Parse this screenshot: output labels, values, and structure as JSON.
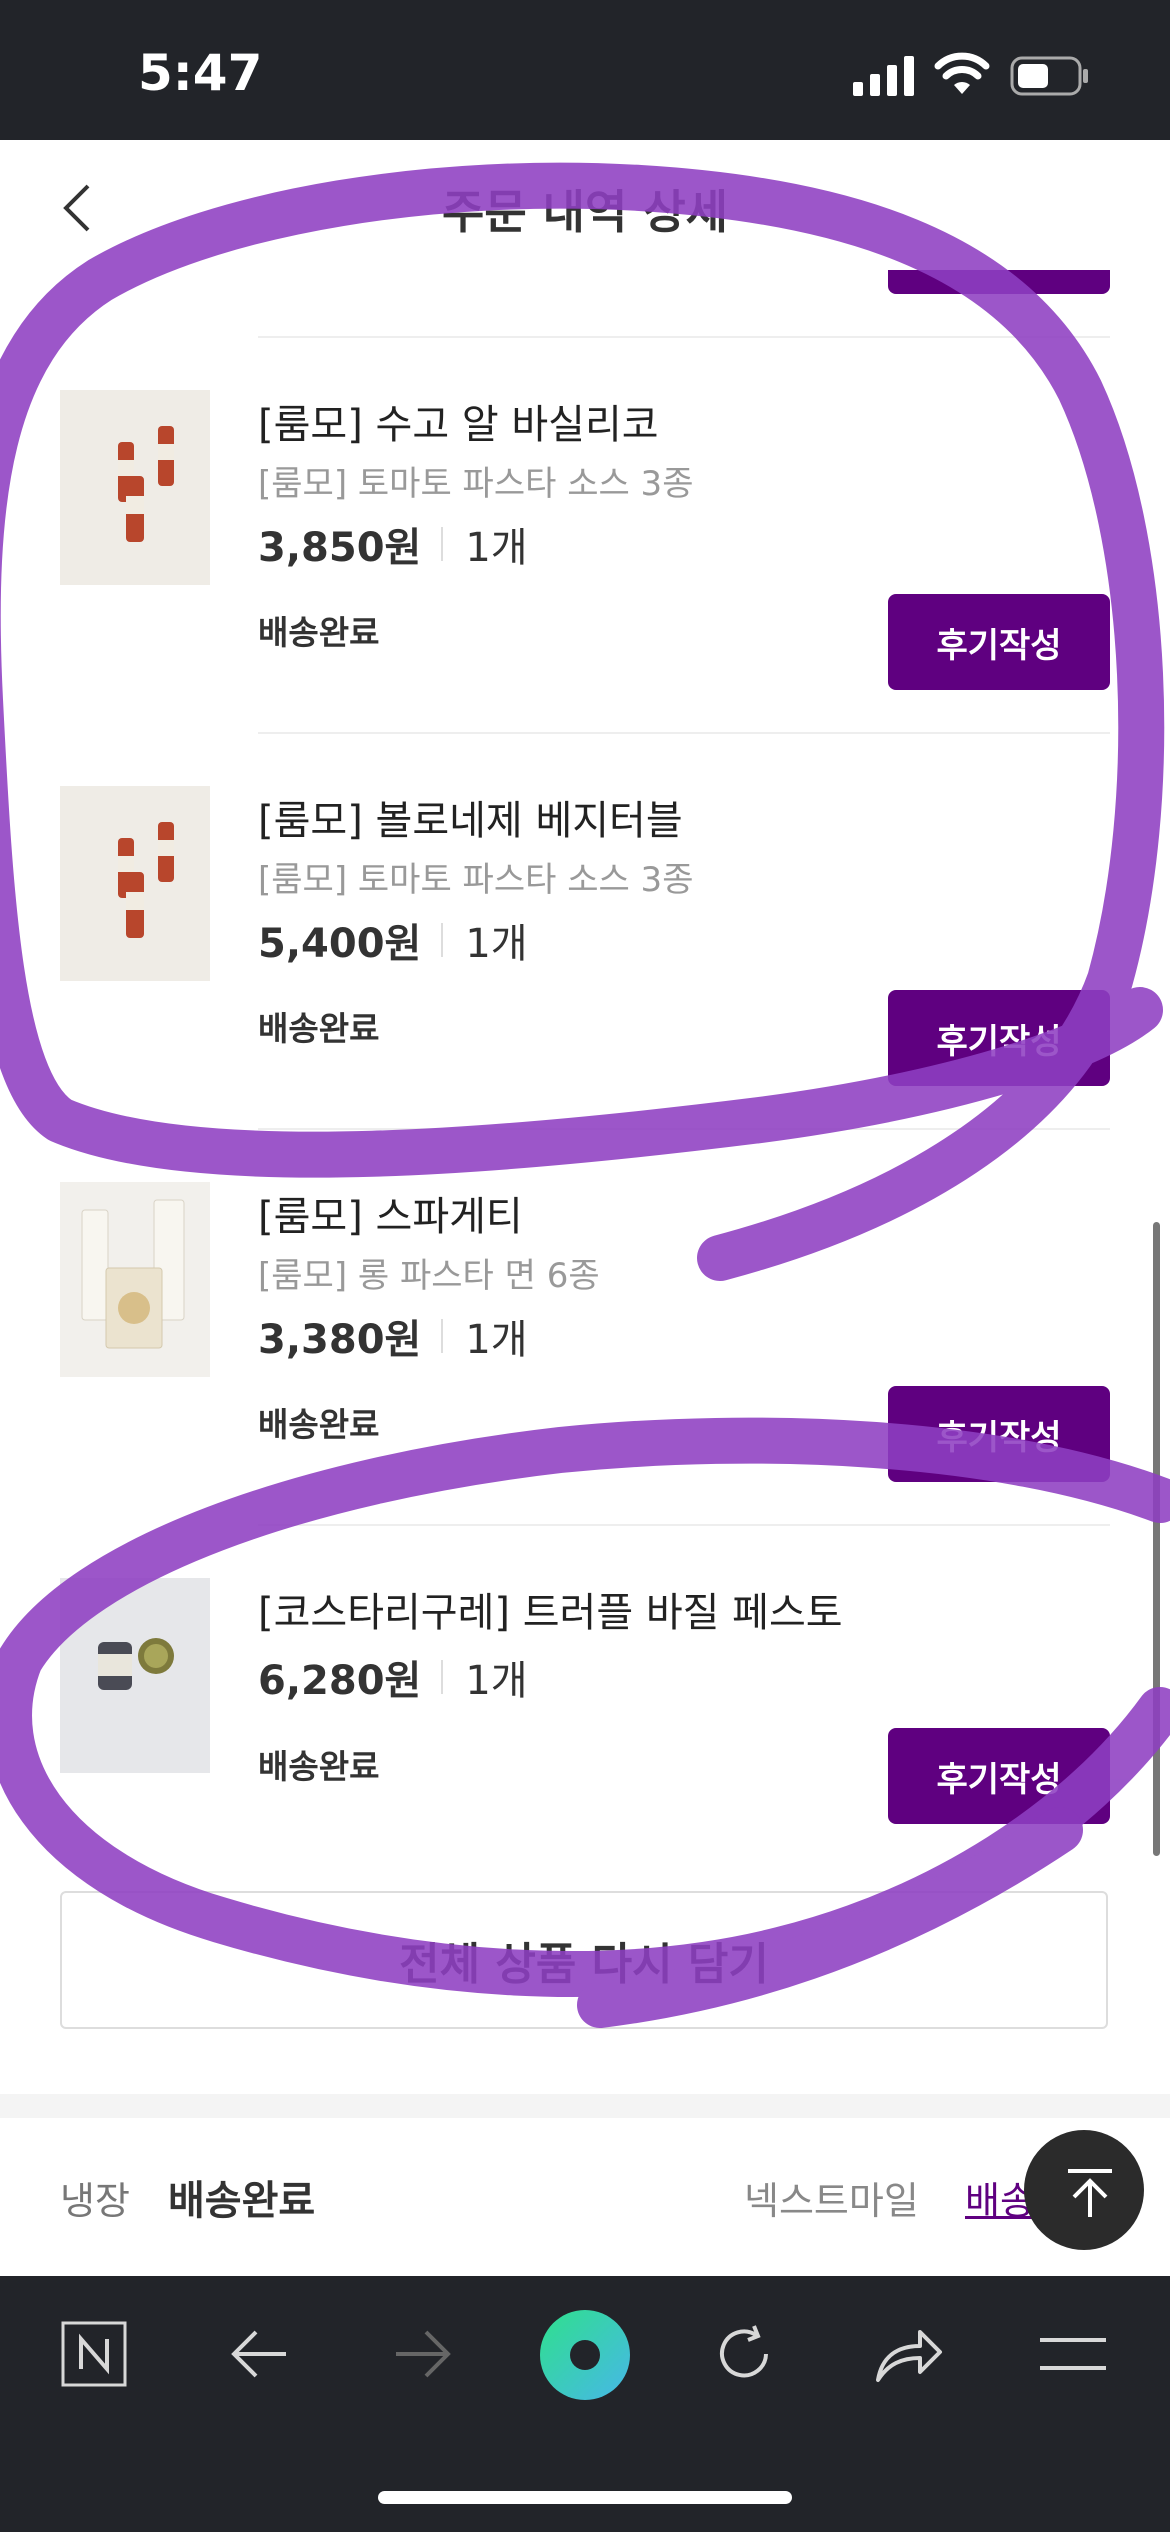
{
  "status_bar": {
    "time": "5:47"
  },
  "header": {
    "title": "주문 내역 상세"
  },
  "items": [
    {
      "name": "[룸모] 수고 알 바실리코",
      "option": "[룸모] 토마토 파스타 소스 3종",
      "price": "3,850원",
      "qty": "1개",
      "status": "배송완료",
      "review_label": "후기작성"
    },
    {
      "name": "[룸모] 볼로네제 베지터블",
      "option": "[룸모] 토마토 파스타 소스 3종",
      "price": "5,400원",
      "qty": "1개",
      "status": "배송완료",
      "review_label": "후기작성"
    },
    {
      "name": "[룸모] 스파게티",
      "option": "[룸모] 롱 파스타 면 6종",
      "price": "3,380원",
      "qty": "1개",
      "status": "배송완료",
      "review_label": "후기작성"
    },
    {
      "name": "[코스타리구레] 트러플 바질 페스토",
      "option": "",
      "price": "6,280원",
      "qty": "1개",
      "status": "배송완료",
      "review_label": "후기작성"
    }
  ],
  "readd_all_label": "전체 상품 다시 담기",
  "shipping": {
    "type": "냉장",
    "status": "배송완료",
    "carrier": "넥스트마일",
    "tracking_link": "배송조회"
  },
  "colors": {
    "accent": "#5f0080",
    "annotation": "#8e3fc2",
    "bar_bg": "#222429"
  },
  "icons": {
    "back": "chevron-left-icon",
    "scroll_top": "arrow-up-to-line-icon"
  }
}
